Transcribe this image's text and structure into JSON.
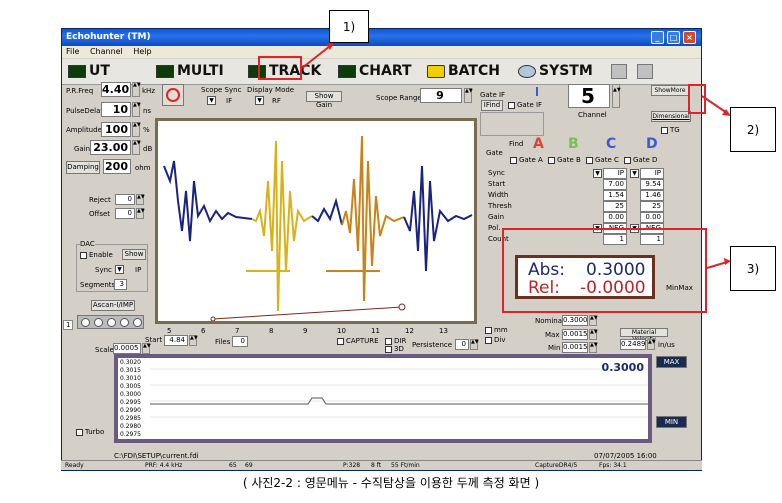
{
  "window": {
    "title": "Echohunter (TM)",
    "menu": [
      "File",
      "Channel",
      "Help"
    ]
  },
  "modes": [
    "UT",
    "MULTI",
    "TRACK",
    "CHART",
    "BATCH",
    "SYSTM"
  ],
  "left_panel": {
    "prf_label": "P.R.Freq",
    "prf_value": "4.40",
    "prf_unit": "kHz",
    "pulse_label": "PulseDelay",
    "pulse_value": "10",
    "pulse_unit": "ns",
    "amp_label": "Amplitude",
    "amp_value": "100",
    "amp_unit": "%",
    "gain_label": "Gain",
    "gain_value": "23.00",
    "gain_unit": "dB",
    "damping_label": "Damping",
    "damping_value": "200",
    "damping_unit": "ohm",
    "reject_label": "Reject",
    "reject_value": "0",
    "offset_label": "Offset",
    "offset_value": "0",
    "dac_label": "DAC",
    "enable_label": "Enable",
    "show_label": "Show",
    "sync_label": "Sync",
    "sync_value": "IP",
    "segments_label": "Segments",
    "segments_value": "3",
    "ascan_label": "Ascan-I/IMP",
    "scale_label": "Scale",
    "scale_value": "0.0005",
    "turbo_label": "Turbo",
    "channel_num": "1"
  },
  "top_controls": {
    "scope_sync_label": "Scope Sync",
    "scope_sync_value": "IF",
    "display_mode_label": "Display Mode",
    "display_mode_value": "RF",
    "show_gain_label": "Show Gain",
    "scope_range_label": "Scope Range",
    "scope_range_value": "9",
    "gate_if_label": "Gate IF",
    "ifind_label": "IFind",
    "gate_if_cb": "Gate IF",
    "channel_label": "Channel",
    "channel_value": "5",
    "showmore_label": "ShowMore",
    "dimensional_label": "Dimensional",
    "tg_label": "TG"
  },
  "gate_table": {
    "gate_label": "Gate",
    "find_label": "Find",
    "letters": [
      "A",
      "B",
      "C",
      "D"
    ],
    "gate_cbs": [
      "Gate A",
      "Gate B",
      "Gate C",
      "Gate D"
    ],
    "rows": [
      {
        "label": "Sync",
        "c": "IP",
        "d": "IP"
      },
      {
        "label": "Start",
        "c": "7.00",
        "d": "9.54"
      },
      {
        "label": "Width",
        "c": "1.54",
        "d": "1.46"
      },
      {
        "label": "Thresh",
        "c": "25",
        "d": "25"
      },
      {
        "label": "Gain",
        "c": "0.00",
        "d": "0.00"
      },
      {
        "label": "Pol.",
        "c": "NEG",
        "d": "NEG"
      },
      {
        "label": "Count",
        "c": "1",
        "d": "1"
      }
    ]
  },
  "readout": {
    "abs_label": "Abs:",
    "abs_value": "0.3000",
    "rel_label": "Rel:",
    "rel_value": "-0.0000",
    "minmax_label": "MinMax"
  },
  "scope_axis": {
    "ticks": [
      "5",
      "6",
      "7",
      "8",
      "9",
      "10",
      "11",
      "12",
      "13"
    ]
  },
  "scope_footer": {
    "start_label": "Start",
    "start_value": "4.84",
    "files_label": "Files",
    "files_value": "0",
    "capture_label": "CAPTURE",
    "dir_label": "DIR",
    "three_d_label": "3D",
    "persistence_label": "Persistence",
    "persistence_value": "0",
    "mm_label": "mm",
    "div_label": "Div",
    "nominal_label": "Nominal",
    "nominal_value": "0.3000",
    "max_label": "Max",
    "max_value": "0.0015",
    "min_label": "Min",
    "min_value": "0.0015",
    "material_label": "Material Velocity",
    "velocity_value": "0.2489",
    "velocity_unit": "in/us"
  },
  "trend": {
    "y_ticks": [
      "0.3020",
      "0.3015",
      "0.3010",
      "0.3005",
      "0.3000",
      "0.2995",
      "0.2990",
      "0.2985",
      "0.2980",
      "0.2975"
    ],
    "value": "0.3000",
    "max_btn": "MAX",
    "min_btn": "MIN",
    "path": "C:\\FDI\\SETUP\\current.fdi",
    "date": "07/07/2005 16:00"
  },
  "status": {
    "ready": "Ready",
    "prf": "PRF: 4.4 kHz",
    "a": "65",
    "b": "69",
    "p": "P:328",
    "bits": "8 ft",
    "lnm": "55 Ft/min",
    "capture": "CaptureDR4/5",
    "fps": "Fps: 34.1"
  },
  "annotations": [
    "1)",
    "2)",
    "3)"
  ],
  "caption": "( 사진2-2 : 영문메뉴 - 수직탐상을 이용한 두께 측정 화면 )",
  "colors": {
    "blue_signal": "#1a237e",
    "gold_signal": "#d9b21a",
    "orange_signal": "#c8841a",
    "annotation_red": "#e0232a"
  }
}
